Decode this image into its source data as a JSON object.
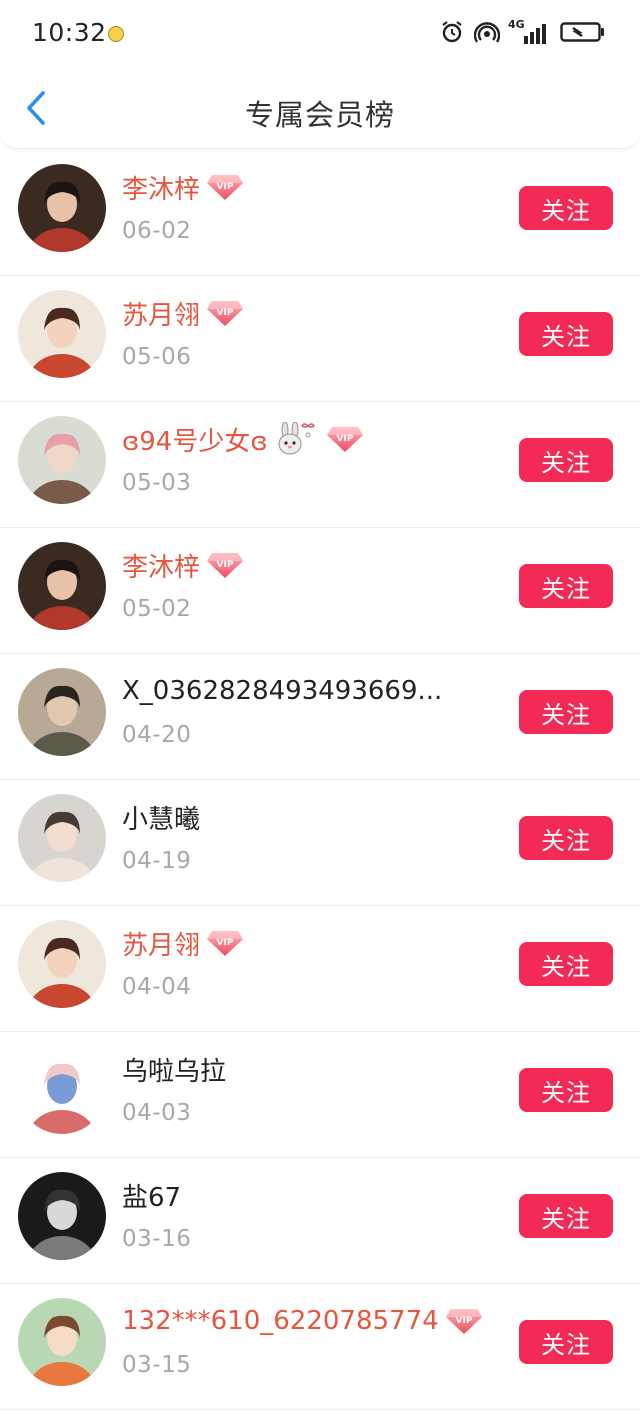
{
  "status_bar": {
    "time": "10:32",
    "network": "4G",
    "icons": [
      "alarm-icon",
      "hotspot-icon",
      "signal-icon",
      "battery-icon"
    ]
  },
  "nav": {
    "title": "专属会员榜",
    "back_icon": "chevron-left-icon"
  },
  "colors": {
    "accent_button": "#f32a55",
    "vip_name": "#e8553f",
    "date_text": "#a8a8a8",
    "back_icon": "#2a8ff0"
  },
  "members": [
    {
      "name": "李沐梓",
      "date": "06-02",
      "vip": true,
      "extra_emoji": false,
      "button": "关注"
    },
    {
      "name": "苏月翎",
      "date": "05-06",
      "vip": true,
      "extra_emoji": false,
      "button": "关注"
    },
    {
      "name": "ɞ94号少女ɞ",
      "date": "05-03",
      "vip": true,
      "extra_emoji": true,
      "button": "关注"
    },
    {
      "name": "李沐梓",
      "date": "05-02",
      "vip": true,
      "extra_emoji": false,
      "button": "关注"
    },
    {
      "name": "X_0362828493493669...",
      "date": "04-20",
      "vip": false,
      "extra_emoji": false,
      "button": "关注"
    },
    {
      "name": "小慧曦",
      "date": "04-19",
      "vip": false,
      "extra_emoji": false,
      "button": "关注"
    },
    {
      "name": "苏月翎",
      "date": "04-04",
      "vip": true,
      "extra_emoji": false,
      "button": "关注"
    },
    {
      "name": "乌啦乌拉",
      "date": "04-03",
      "vip": false,
      "extra_emoji": false,
      "button": "关注"
    },
    {
      "name": "盐67",
      "date": "03-16",
      "vip": false,
      "extra_emoji": false,
      "button": "关注"
    },
    {
      "name": "132***610_6220785774",
      "date": "03-15",
      "vip": true,
      "extra_emoji": false,
      "button": "关注"
    }
  ]
}
